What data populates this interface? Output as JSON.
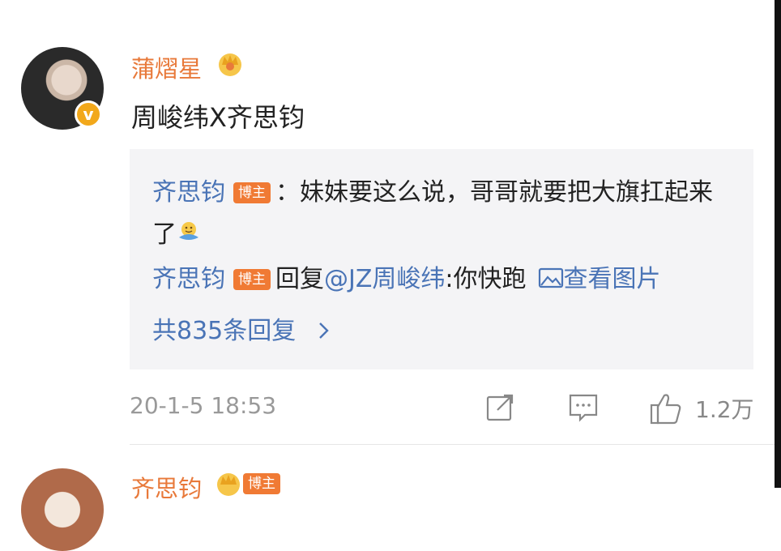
{
  "comment": {
    "author": "蒲熠星",
    "verified_badge": "v",
    "content": "周峻纬X齐思钧",
    "reply_preview": {
      "reply1": {
        "user": "齐思钧",
        "badge": "博主",
        "text": "：妹妹要这么说，哥哥就要把大旗扛起来了"
      },
      "reply2": {
        "user": "齐思钧",
        "badge": "博主",
        "prefix": "回复",
        "mention": "@JZ周峻纬",
        "text": ":你快跑",
        "view_image": "查看图片"
      },
      "total_replies": "共835条回复"
    },
    "timestamp": "20-1-5 18:53",
    "like_count": "1.2万"
  },
  "next_comment": {
    "author": "齐思钧",
    "badge": "博主"
  },
  "colors": {
    "author_orange": "#e8793a",
    "link_blue": "#4a74b6",
    "badge_orange": "#f07a34",
    "vip_gold": "#f2a81b",
    "reply_bg": "#f4f4f6"
  },
  "icons": [
    "crown-icon",
    "verified-icon",
    "hug-emoji-icon",
    "image-icon",
    "chevron-right-icon",
    "share-icon",
    "comment-icon",
    "like-icon"
  ]
}
